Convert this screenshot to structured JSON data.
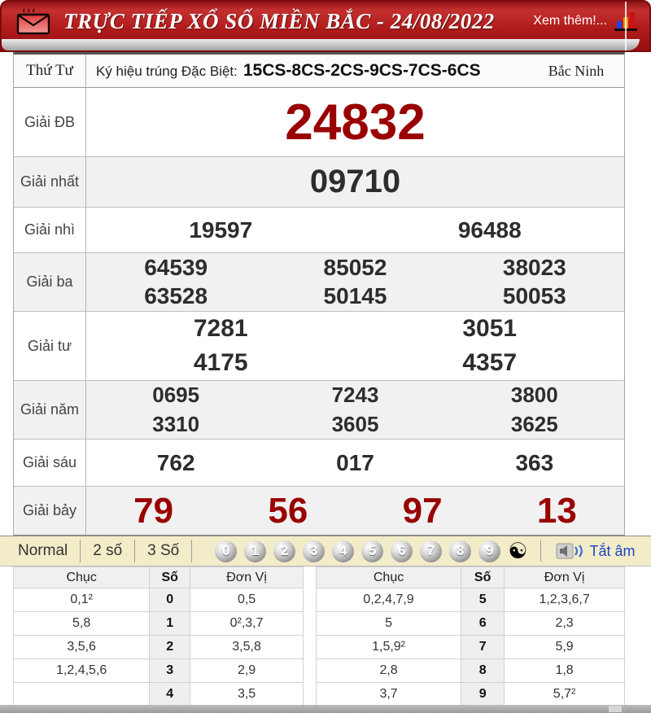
{
  "header": {
    "title": "TRỰC TIẾP XỔ SỐ MIỀN BẮC - 24/08/2022",
    "more_link": "Xem thêm!...",
    "accent_red": "#b01b1b",
    "prize_red": "#990000"
  },
  "info_row": {
    "weekday": "Thứ Tư",
    "symbol_label": "Ký hiệu trúng Đặc Biệt:",
    "symbol_value": "15CS-8CS-2CS-9CS-7CS-6CS",
    "province": "Bắc Ninh"
  },
  "prizes": [
    {
      "label": "Giải ĐB",
      "numbers": [
        "24832"
      ]
    },
    {
      "label": "Giải nhất",
      "numbers": [
        "09710"
      ]
    },
    {
      "label": "Giải nhì",
      "numbers": [
        "19597",
        "96488"
      ]
    },
    {
      "label": "Giải ba",
      "numbers": [
        "64539",
        "85052",
        "38023",
        "63528",
        "50145",
        "50053"
      ]
    },
    {
      "label": "Giải tư",
      "numbers": [
        "7281",
        "3051",
        "4175",
        "4357"
      ]
    },
    {
      "label": "Giải năm",
      "numbers": [
        "0695",
        "7243",
        "3800",
        "3310",
        "3605",
        "3625"
      ]
    },
    {
      "label": "Giải sáu",
      "numbers": [
        "762",
        "017",
        "363"
      ]
    },
    {
      "label": "Giải bảy",
      "numbers": [
        "79",
        "56",
        "97",
        "13"
      ]
    }
  ],
  "controls": {
    "modes": [
      "Normal",
      "2 số",
      "3 Số"
    ],
    "digits": [
      "0",
      "1",
      "2",
      "3",
      "4",
      "5",
      "6",
      "7",
      "8",
      "9"
    ],
    "yinyang": "☯",
    "mute_label": "Tắt âm"
  },
  "stats": {
    "headers": {
      "chuc": "Chục",
      "so": "Số",
      "donvi": "Đơn Vị"
    },
    "left_rows": [
      {
        "chuc": "0,1²",
        "so": "0",
        "donvi": "0,5"
      },
      {
        "chuc": "5,8",
        "so": "1",
        "donvi": "0²,3,7"
      },
      {
        "chuc": "3,5,6",
        "so": "2",
        "donvi": "3,5,8"
      },
      {
        "chuc": "1,2,4,5,6",
        "so": "3",
        "donvi": "2,9"
      },
      {
        "chuc": "",
        "so": "4",
        "donvi": "3,5"
      }
    ],
    "right_rows": [
      {
        "chuc": "0,2,4,7,9",
        "so": "5",
        "donvi": "1,2,3,6,7"
      },
      {
        "chuc": "5",
        "so": "6",
        "donvi": "2,3"
      },
      {
        "chuc": "1,5,9²",
        "so": "7",
        "donvi": "5,9"
      },
      {
        "chuc": "2,8",
        "so": "8",
        "donvi": "1,8"
      },
      {
        "chuc": "3,7",
        "so": "9",
        "donvi": "5,7²"
      }
    ]
  }
}
